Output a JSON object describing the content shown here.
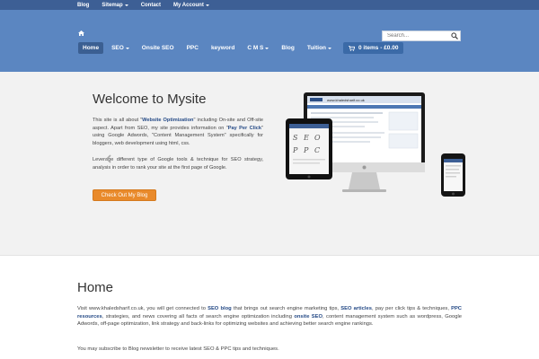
{
  "topnav": {
    "items": [
      {
        "label": "Blog",
        "dropdown": false
      },
      {
        "label": "Sitemap",
        "dropdown": true
      },
      {
        "label": "Contact",
        "dropdown": false
      },
      {
        "label": "My Account",
        "dropdown": true
      }
    ]
  },
  "search": {
    "placeholder": "Search..."
  },
  "mainnav": {
    "items": [
      {
        "label": "Home",
        "active": true
      },
      {
        "label": "SEO",
        "dropdown": true
      },
      {
        "label": "Onsite SEO"
      },
      {
        "label": "PPC"
      },
      {
        "label": "keyword"
      },
      {
        "label": "C M S",
        "dropdown": true
      },
      {
        "label": "Blog"
      },
      {
        "label": "Tuition",
        "dropdown": true
      }
    ],
    "cart": "0 items - £0.00"
  },
  "hero": {
    "title": "Welcome to Mysite",
    "p1": {
      "t1": "This site is all about \"",
      "b1": "Website Optimization",
      "t2": "\" including On-site and Off-site aspect. Apart from SEO, my site provides information on \"",
      "b2": "Pay Per Click",
      "t3": "\" using Google Adwords, \"Content Management System\" specifically for bloggers, web development using html, css."
    },
    "p2": "Leverage different type of Google tools & technique for SEO strategy, analysis in order to rank your site at the first page of Google.",
    "cta": "Check Out My Blog",
    "screen_url": "www.khaledsharif.co.uk",
    "tablet_letters": [
      "S",
      "E",
      "O",
      "P",
      "P",
      "C"
    ]
  },
  "content": {
    "title": "Home",
    "p1": {
      "t1": "Visit www.khaledsharif.co.uk, you will get connected to ",
      "b1": "SEO blog",
      "t2": " that brings out search engine marketing tips, ",
      "b2": "SEO articles",
      "t3": ", pay per click tips & techniques, ",
      "b3": "PPC resources",
      "t4": ", strategies, and news covering all facts of search engine optimization including ",
      "b4": "onsite SEO",
      "t5": ", content management system such as wordpress, Google Adwords, off-page optimization, link strategy and back-links for optimizing websites and achieving better search engine rankings."
    },
    "p2": "You may subscribe to Blog newsletter to receive latest SEO & PPC tips and techniques."
  },
  "colors": {
    "topbar": "#3d5f95",
    "header": "#5b86c1",
    "accent_link": "#254a86",
    "cta": "#e98a2b",
    "hero_bg": "#f2f2f2"
  },
  "icons": [
    "home-icon",
    "search-icon",
    "cart-icon",
    "chevron-left-icon",
    "chevron-right-icon"
  ]
}
